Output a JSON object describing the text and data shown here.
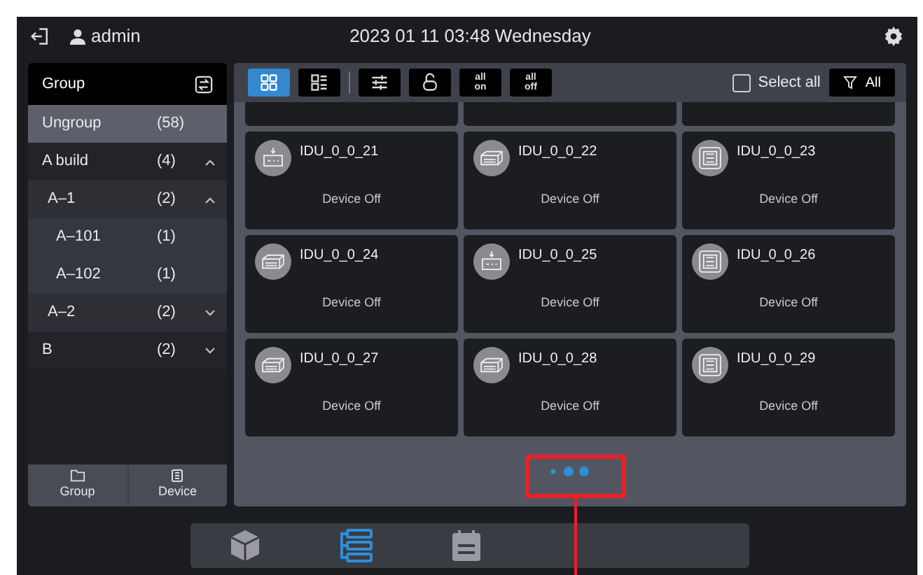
{
  "header": {
    "user": "admin",
    "datetime": "2023 01 11 03:48 Wednesday"
  },
  "sidebar": {
    "title": "Group",
    "items": [
      {
        "label": "Ungroup",
        "count": "(58)",
        "selected": true
      },
      {
        "label": "A build",
        "count": "(4)",
        "selected": false,
        "expanded": true,
        "children": [
          {
            "label": "A–1",
            "count": "(2)",
            "selected": false,
            "expanded": true,
            "children": [
              {
                "label": "A–101",
                "count": "(1)",
                "selected": false
              },
              {
                "label": "A–102",
                "count": "(1)",
                "selected": false
              }
            ]
          },
          {
            "label": "A–2",
            "count": "(2)",
            "selected": false,
            "expanded": false
          }
        ]
      },
      {
        "label": "B",
        "count": "(2)",
        "selected": false,
        "expanded": false
      }
    ],
    "buttons": [
      {
        "kind": "group",
        "label": "Group"
      },
      {
        "kind": "device",
        "label": "Device"
      }
    ]
  },
  "toolbar": {
    "tools": [
      {
        "kind": "grid",
        "selected": true
      },
      {
        "kind": "list",
        "selected": false
      },
      {
        "kind": "sliders",
        "selected": false
      },
      {
        "kind": "lock",
        "selected": false
      },
      {
        "kind": "text",
        "label": "all\non",
        "selected": false
      },
      {
        "kind": "text",
        "label": "all\noff",
        "selected": false
      }
    ],
    "select_all": {
      "label": "Select all",
      "checked": false
    },
    "filter": {
      "label": "All"
    }
  },
  "devices": [
    {
      "kind": "cassette",
      "name": "IDU_0_0_21",
      "status": "Device Off"
    },
    {
      "kind": "duct",
      "name": "IDU_0_0_22",
      "status": "Device Off"
    },
    {
      "kind": "square",
      "name": "IDU_0_0_23",
      "status": "Device Off"
    },
    {
      "kind": "duct",
      "name": "IDU_0_0_24",
      "status": "Device Off"
    },
    {
      "kind": "cassette",
      "name": "IDU_0_0_25",
      "status": "Device Off"
    },
    {
      "kind": "square",
      "name": "IDU_0_0_26",
      "status": "Device Off"
    },
    {
      "kind": "duct",
      "name": "IDU_0_0_27",
      "status": "Device Off"
    },
    {
      "kind": "duct",
      "name": "IDU_0_0_28",
      "status": "Device Off"
    },
    {
      "kind": "square",
      "name": "IDU_0_0_29",
      "status": "Device Off"
    }
  ],
  "nav_tabs": [
    {
      "kind": "cube",
      "selected": false
    },
    {
      "kind": "tree",
      "selected": true
    },
    {
      "kind": "calendar",
      "selected": false
    }
  ]
}
